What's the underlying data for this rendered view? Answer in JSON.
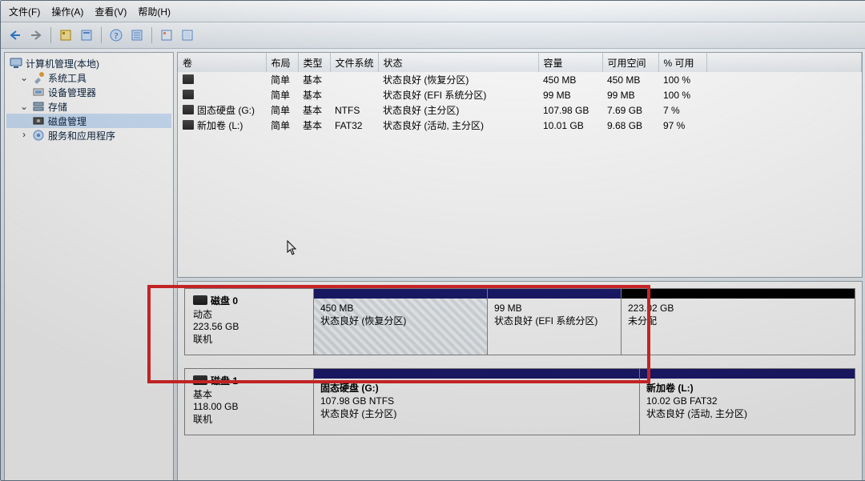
{
  "menu": {
    "file": "文件(F)",
    "action": "操作(A)",
    "view": "查看(V)",
    "help": "帮助(H)"
  },
  "tree": {
    "root": "计算机管理(本地)",
    "systools": "系统工具",
    "devmgr": "设备管理器",
    "storage": "存储",
    "diskmgmt": "磁盘管理",
    "services": "服务和应用程序"
  },
  "cols": {
    "volume": "卷",
    "layout": "布局",
    "type": "类型",
    "fs": "文件系统",
    "status": "状态",
    "capacity": "容量",
    "free": "可用空间",
    "pct": "% 可用"
  },
  "volumes": [
    {
      "name": "",
      "layout": "简单",
      "type": "基本",
      "fs": "",
      "status": "状态良好 (恢复分区)",
      "cap": "450 MB",
      "free": "450 MB",
      "pct": "100 %"
    },
    {
      "name": "",
      "layout": "简单",
      "type": "基本",
      "fs": "",
      "status": "状态良好 (EFI 系统分区)",
      "cap": "99 MB",
      "free": "99 MB",
      "pct": "100 %"
    },
    {
      "name": "固态硬盘 (G:)",
      "layout": "简单",
      "type": "基本",
      "fs": "NTFS",
      "status": "状态良好 (主分区)",
      "cap": "107.98 GB",
      "free": "7.69 GB",
      "pct": "7 %"
    },
    {
      "name": "新加卷 (L:)",
      "layout": "简单",
      "type": "基本",
      "fs": "FAT32",
      "status": "状态良好 (活动, 主分区)",
      "cap": "10.01 GB",
      "free": "9.68 GB",
      "pct": "97 %"
    }
  ],
  "disk0": {
    "title": "磁盘 0",
    "kind": "动态",
    "size": "223.56 GB",
    "state": "联机",
    "p1": {
      "size": "450 MB",
      "status": "状态良好 (恢复分区)"
    },
    "p2": {
      "size": "99 MB",
      "status": "状态良好 (EFI 系统分区)"
    },
    "p3": {
      "size": "223.02 GB",
      "status": "未分配"
    }
  },
  "disk1": {
    "title": "磁盘 1",
    "kind": "基本",
    "size": "118.00 GB",
    "state": "联机",
    "p1": {
      "name": "固态硬盘  (G:)",
      "line2": "107.98 GB NTFS",
      "status": "状态良好 (主分区)"
    },
    "p2": {
      "name": "新加卷  (L:)",
      "line2": "10.02 GB FAT32",
      "status": "状态良好 (活动, 主分区)"
    }
  }
}
